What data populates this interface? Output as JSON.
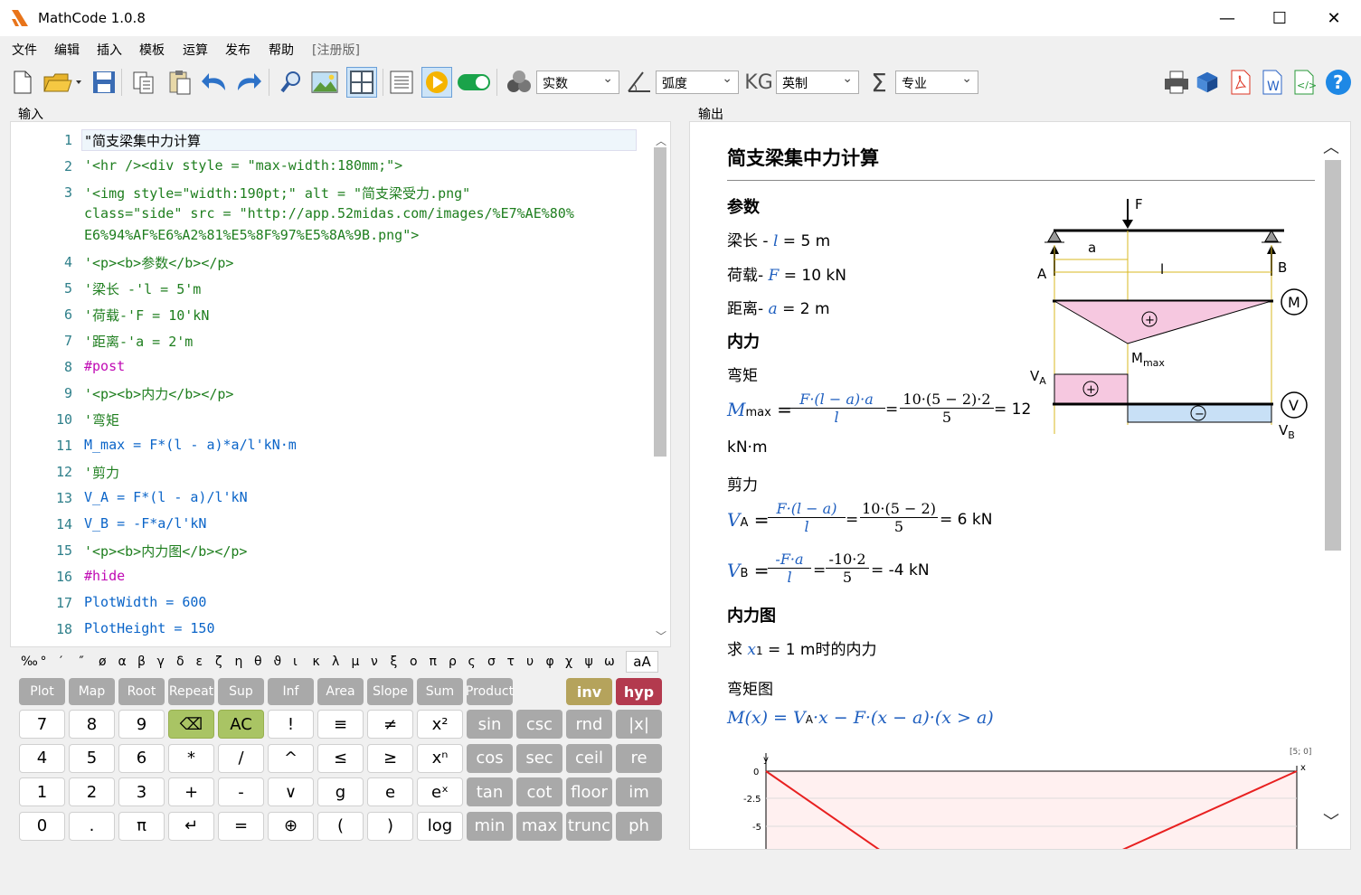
{
  "window": {
    "title": "MathCode 1.0.8"
  },
  "menu": [
    "文件",
    "编辑",
    "插入",
    "模板",
    "运算",
    "发布",
    "帮助",
    "[注册版]"
  ],
  "toolbar": {
    "number_mode": "实数",
    "angle_mode": "弧度",
    "unit_mode": "英制",
    "level_mode": "专业"
  },
  "panels": {
    "input_label": "输入",
    "output_label": "输出"
  },
  "editor": {
    "lines": [
      {
        "n": "1",
        "text": "\"简支梁集中力计算"
      },
      {
        "n": "2",
        "text": "'<hr /><div style = \"max-width:180mm;\">"
      },
      {
        "n": "3",
        "text": "'<img style=\"width:190pt;\" alt = \"简支梁受力.png\""
      },
      {
        "n": "",
        "text": "class=\"side\" src = \"http://app.52midas.com/images/%E7%AE%80%"
      },
      {
        "n": "",
        "text": "E6%94%AF%E6%A2%81%E5%8F%97%E5%8A%9B.png\">"
      },
      {
        "n": "4",
        "text": "'<p><b>参数</b></p>"
      },
      {
        "n": "5",
        "text": "'梁长 -'l = 5'm"
      },
      {
        "n": "6",
        "text": "'荷载-'F = 10'kN"
      },
      {
        "n": "7",
        "text": "'距离-'a = 2'm"
      },
      {
        "n": "8",
        "text": "#post"
      },
      {
        "n": "9",
        "text": "'<p><b>内力</b></p>"
      },
      {
        "n": "10",
        "text": "'弯矩"
      },
      {
        "n": "11",
        "text": "M_max = F*(l - a)*a/l'kN·m"
      },
      {
        "n": "12",
        "text": "'剪力"
      },
      {
        "n": "13",
        "text": "V_A = F*(l - a)/l'kN"
      },
      {
        "n": "14",
        "text": "V_B = -F*a/l'kN"
      },
      {
        "n": "15",
        "text": "'<p><b>内力图</b></p>"
      },
      {
        "n": "16",
        "text": "#hide"
      },
      {
        "n": "17",
        "text": "PlotWidth = 600"
      },
      {
        "n": "18",
        "text": "PlotHeight = 150"
      }
    ]
  },
  "greek": [
    "‰",
    "°",
    "′",
    "″",
    "ø",
    "α",
    "β",
    "γ",
    "δ",
    "ε",
    "ζ",
    "η",
    "θ",
    "ϑ",
    "ι",
    "κ",
    "λ",
    "μ",
    "ν",
    "ξ",
    "ο",
    "π",
    "ρ",
    "ς",
    "σ",
    "τ",
    "υ",
    "φ",
    "χ",
    "ψ",
    "ω"
  ],
  "case_toggle": "aA",
  "keypad": {
    "row0": [
      "Plot",
      "Map",
      "Root",
      "Repeat",
      "Sup",
      "Inf",
      "Area",
      "Slope",
      "Sum",
      "Product"
    ],
    "inv": "inv",
    "hyp": "hyp",
    "row1": [
      "7",
      "8",
      "9",
      "⌫",
      "AC",
      "!",
      "≡",
      "≠",
      "x²",
      "sin",
      "csc",
      "rnd",
      "|x|"
    ],
    "row2": [
      "4",
      "5",
      "6",
      "*",
      "/",
      "^",
      "≤",
      "≥",
      "xⁿ",
      "cos",
      "sec",
      "ceil",
      "re"
    ],
    "row3": [
      "1",
      "2",
      "3",
      "+",
      "-",
      "∨",
      "g",
      "e",
      "eˣ",
      "tan",
      "cot",
      "floor",
      "im"
    ],
    "row4": [
      "0",
      ".",
      "π",
      "↵",
      "=",
      "⊕",
      "(",
      ")",
      "log",
      "min",
      "max",
      "trunc",
      "ph"
    ]
  },
  "output": {
    "title": "简支梁集中力计算",
    "params_heading": "参数",
    "p1_label": "梁长 -",
    "p1_var": "l",
    "p1_val": "= 5 m",
    "p2_label": "荷载-",
    "p2_var": "F",
    "p2_val": "= 10 kN",
    "p3_label": "距离-",
    "p3_var": "a",
    "p3_val": "= 2 m",
    "internal_heading": "内力",
    "moment_label": "弯矩",
    "mmax_var": "M",
    "mmax_sub": "max",
    "mmax_num": "F·(l − a)·a",
    "mmax_den": "l",
    "mmax_num2": "10·(5 − 2)·2",
    "mmax_den2": "5",
    "mmax_result": "= 12",
    "mmax_unit": "kN·m",
    "shear_label": "剪力",
    "va_var": "V",
    "va_sub": "A",
    "va_num": "F·(l − a)",
    "va_den": "l",
    "va_num2": "10·(5 − 2)",
    "va_den2": "5",
    "va_result": "= 6 kN",
    "vb_var": "V",
    "vb_sub": "B",
    "vb_num": "-F·a",
    "vb_den": "l",
    "vb_num2": "-10·2",
    "vb_den2": "5",
    "vb_result": "= -4 kN",
    "diagram_heading": "内力图",
    "ask_prefix": "求",
    "ask_var": "x",
    "ask_sub": "1",
    "ask_suffix": "= 1 m时的内力",
    "moment_plot_label": "弯矩图",
    "mx_formula": "M(x) = V",
    "mx_rest": "·x − F·(x − a)·(x > a)",
    "plot_ylabel": "y",
    "plot_xlabel": "x",
    "plot_corner": "[5; 0]",
    "plot_ticks": [
      "0",
      "-2.5",
      "-5"
    ],
    "figure_labels": {
      "F": "F",
      "a": "a",
      "l": "l",
      "A": "A",
      "B": "B",
      "M": "M",
      "Mmax": "M",
      "Mmax_sub": "max",
      "VA": "V",
      "VA_sub": "A",
      "V": "V",
      "VB": "V",
      "VB_sub": "B"
    }
  }
}
